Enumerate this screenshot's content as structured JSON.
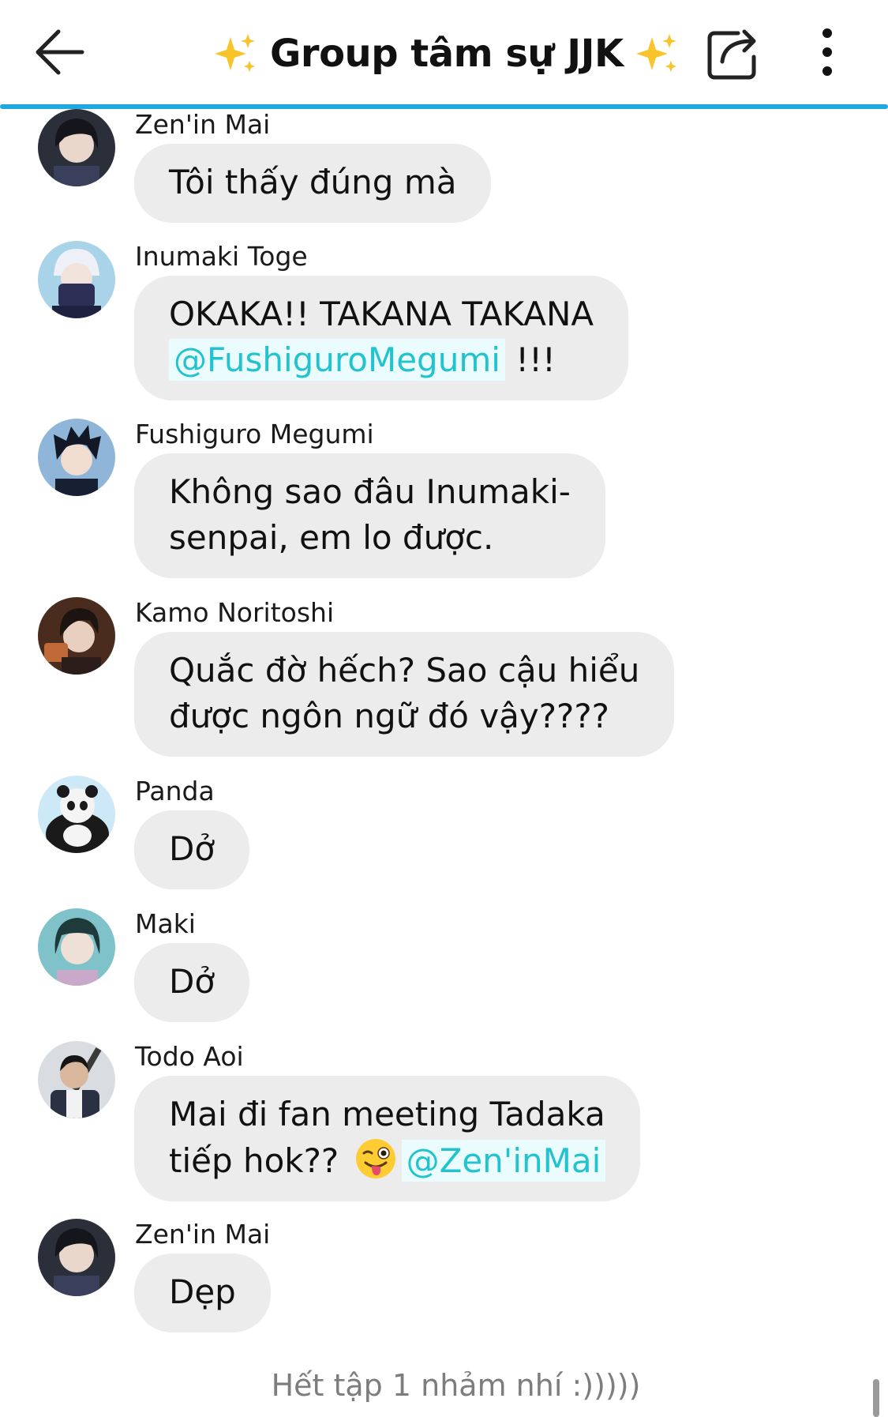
{
  "header": {
    "title": "Group tâm sự JJK",
    "back_icon": "arrow-left-icon",
    "share_icon": "share-icon",
    "more_icon": "more-vertical-icon",
    "accent_color": "#1ea7e1"
  },
  "messages": [
    {
      "sender": "Zen'in Mai",
      "text": "Tôi thấy đúng mà"
    },
    {
      "sender": "Inumaki Toge",
      "text_line1": "OKAKA!! TAKANA TAKANA",
      "mention": "@FushiguroMegumi",
      "text_after": " !!!"
    },
    {
      "sender": "Fushiguro Megumi",
      "text_line1": "Không sao đâu Inumaki-",
      "text_line2": "senpai, em lo được."
    },
    {
      "sender": "Kamo Noritoshi",
      "text_line1": "Quắc đờ hếch? Sao cậu hiểu",
      "text_line2": "được ngôn ngữ đó vậy????"
    },
    {
      "sender": "Panda",
      "text": "Dở"
    },
    {
      "sender": "Maki",
      "text": "Dở"
    },
    {
      "sender": "Todo Aoi",
      "text_line1": "Mai đi fan meeting Tadaka",
      "text_line2_before": "tiếp hok?? ",
      "emoji": "winking-face-with-tongue",
      "mention": "@Zen'inMai"
    },
    {
      "sender": "Zen'in Mai",
      "text": "Dẹp"
    }
  ],
  "footer": {
    "text": "Hết tập 1 nhảm nhí :)))))"
  },
  "colors": {
    "bubble": "#ececec",
    "mention": "#22c3cf"
  }
}
